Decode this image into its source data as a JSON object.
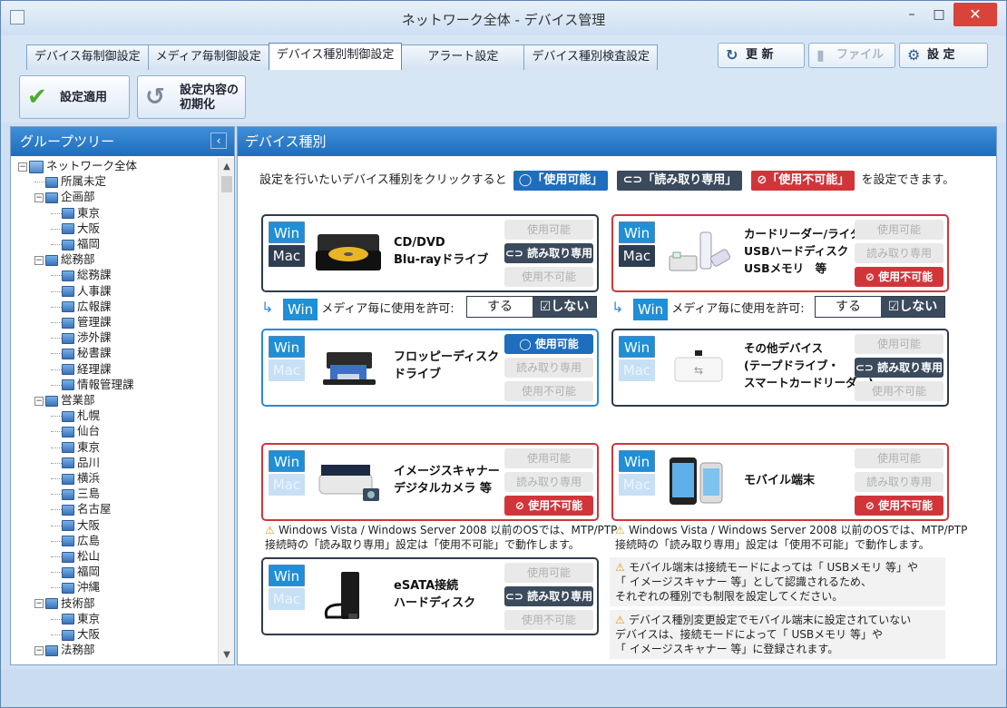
{
  "window": {
    "title": "ネットワーク全体 - デバイス管理",
    "minimize": "–",
    "maximize": "□",
    "close": "✕"
  },
  "tabs": [
    "デバイス毎制御設定",
    "メディア毎制御設定",
    "デバイス種別制御設定",
    "アラート設定",
    "デバイス種別検査設定"
  ],
  "toolbar": {
    "refresh": "更 新",
    "file": "ファイル",
    "settings": "設 定",
    "apply": "設定適用",
    "reset": "設定内容の\n初期化"
  },
  "left_panel": {
    "title": "グループツリー",
    "tree": [
      {
        "label": "ネットワーク全体",
        "level": 0,
        "expander": "⊟",
        "kind": "net"
      },
      {
        "label": "所属未定",
        "level": 1
      },
      {
        "label": "企画部",
        "level": 1,
        "expander": "⊟"
      },
      {
        "label": "東京",
        "level": 2
      },
      {
        "label": "大阪",
        "level": 2
      },
      {
        "label": "福岡",
        "level": 2
      },
      {
        "label": "総務部",
        "level": 1,
        "expander": "⊟"
      },
      {
        "label": "総務課",
        "level": 2
      },
      {
        "label": "人事課",
        "level": 2
      },
      {
        "label": "広報課",
        "level": 2
      },
      {
        "label": "管理課",
        "level": 2
      },
      {
        "label": "渉外課",
        "level": 2
      },
      {
        "label": "秘書課",
        "level": 2
      },
      {
        "label": "経理課",
        "level": 2
      },
      {
        "label": "情報管理課",
        "level": 2
      },
      {
        "label": "営業部",
        "level": 1,
        "expander": "⊟"
      },
      {
        "label": "札幌",
        "level": 2
      },
      {
        "label": "仙台",
        "level": 2
      },
      {
        "label": "東京",
        "level": 2
      },
      {
        "label": "品川",
        "level": 2
      },
      {
        "label": "横浜",
        "level": 2
      },
      {
        "label": "三島",
        "level": 2
      },
      {
        "label": "名古屋",
        "level": 2
      },
      {
        "label": "大阪",
        "level": 2
      },
      {
        "label": "広島",
        "level": 2
      },
      {
        "label": "松山",
        "level": 2
      },
      {
        "label": "福岡",
        "level": 2
      },
      {
        "label": "沖縄",
        "level": 2
      },
      {
        "label": "技術部",
        "level": 1,
        "expander": "⊟"
      },
      {
        "label": "東京",
        "level": 2
      },
      {
        "label": "大阪",
        "level": 2
      },
      {
        "label": "法務部",
        "level": 1,
        "expander": "⊟"
      }
    ]
  },
  "main": {
    "title": "デバイス種別",
    "instruction_pre": "設定を行いたいデバイス種別をクリックすると",
    "pill_allow": "◯「使用可能」",
    "pill_readonly": "⊂⊃「読み取り専用」",
    "pill_deny": "⊘「使用不可能」",
    "instruction_post": "を設定できます。",
    "os_win": "Win",
    "os_mac": "Mac",
    "btn_allow": "使用可能",
    "btn_readonly": "読み取り専用",
    "btn_deny": "使用不可能",
    "btn_allow_on": "◯ 使用可能",
    "btn_readonly_on": "⊂⊃ 読み取り専用",
    "btn_deny_on": "⊘ 使用不可能",
    "devices": [
      {
        "name": "CD/DVD\nBlu-rayドライブ",
        "state": "readonly",
        "mac": true
      },
      {
        "name": "カードリーダー/ライター\nUSBハードディスク\nUSBメモリ　等",
        "state": "deny",
        "mac": true
      },
      {
        "name": "フロッピーディスク\nドライブ",
        "state": "allow",
        "mac": false
      },
      {
        "name": "その他デバイス\n(テープドライブ・\nスマートカードリーダー)",
        "state": "readonly",
        "mac": false
      },
      {
        "name": "イメージスキャナー\nデジタルカメラ 等",
        "state": "deny",
        "mac": false
      },
      {
        "name": "モバイル端末",
        "state": "deny",
        "mac": false
      },
      {
        "name": "eSATA接続\nハードディスク",
        "state": "readonly",
        "mac": false
      }
    ],
    "media_perm": {
      "label": "メディア毎に使用を許可:",
      "yes": "する",
      "no": "☑しない",
      "badge": "Win"
    },
    "warning_scanner": "Windows Vista / Windows Server 2008 以前のOSでは、MTP/PTP\n接続時の「読み取り専用」設定は「使用不可能」で動作します。",
    "warning_mobile": "Windows Vista / Windows Server 2008 以前のOSでは、MTP/PTP\n接続時の「読み取り専用」設定は「使用不可能」で動作します。",
    "note1": "モバイル端末は接続モードによっては「 USBメモリ 等」や\n「 イメージスキャナー 等」として認識されるため、\nそれぞれの種別でも制限を設定してください。",
    "note2": "デバイス種別変更設定でモバイル端末に設定されていない\nデバイスは、接続モードによって「 USBメモリ 等」や\n「 イメージスキャナー 等」に登録されます。"
  }
}
